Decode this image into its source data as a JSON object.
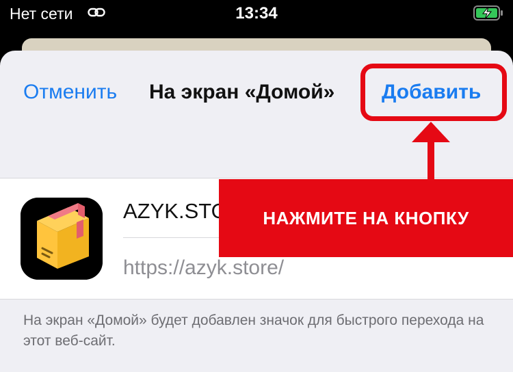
{
  "status_bar": {
    "carrier": "Нет сети",
    "time": "13:34",
    "link_icon": "link-icon",
    "battery_icon": "battery-charging-icon"
  },
  "dialog": {
    "cancel_label": "Отменить",
    "title": "На экран «Домой»",
    "add_label": "Добавить"
  },
  "app": {
    "icon": "box-package-icon",
    "name": "AZYK.STORE",
    "url": "https://azyk.store/"
  },
  "footnote": "На экран «Домой» будет добавлен значок для быстрого перехода на этот веб-сайт.",
  "annotation": {
    "banner_text": "НАЖМИТЕ НА КНОПКУ",
    "color": "#e50914"
  },
  "colors": {
    "accent": "#1a7cf0",
    "sheet_bg": "#efeff4"
  }
}
